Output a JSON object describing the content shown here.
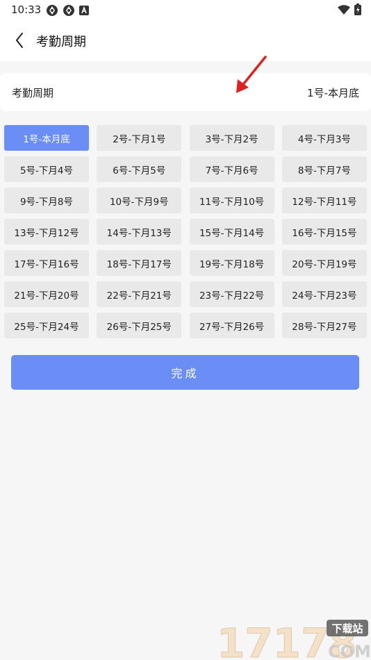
{
  "status_bar": {
    "time": "10:33",
    "left_icons": [
      "sync-icon",
      "sync-icon",
      "font-a-icon"
    ],
    "right_icons": [
      "wifi-icon",
      "battery-icon"
    ]
  },
  "nav": {
    "back_icon": "chevron-left-icon",
    "title": "考勤周期"
  },
  "field": {
    "label": "考勤周期",
    "value": "1号-本月底"
  },
  "options": [
    {
      "label": "1号-本月底",
      "selected": true
    },
    {
      "label": "2号-下月1号",
      "selected": false
    },
    {
      "label": "3号-下月2号",
      "selected": false
    },
    {
      "label": "4号-下月3号",
      "selected": false
    },
    {
      "label": "5号-下月4号",
      "selected": false
    },
    {
      "label": "6号-下月5号",
      "selected": false
    },
    {
      "label": "7号-下月6号",
      "selected": false
    },
    {
      "label": "8号-下月7号",
      "selected": false
    },
    {
      "label": "9号-下月8号",
      "selected": false
    },
    {
      "label": "10号-下月9号",
      "selected": false
    },
    {
      "label": "11号-下月10号",
      "selected": false
    },
    {
      "label": "12号-下月11号",
      "selected": false
    },
    {
      "label": "13号-下月12号",
      "selected": false
    },
    {
      "label": "14号-下月13号",
      "selected": false
    },
    {
      "label": "15号-下月14号",
      "selected": false
    },
    {
      "label": "16号-下月15号",
      "selected": false
    },
    {
      "label": "17号-下月16号",
      "selected": false
    },
    {
      "label": "18号-下月17号",
      "selected": false
    },
    {
      "label": "19号-下月18号",
      "selected": false
    },
    {
      "label": "20号-下月19号",
      "selected": false
    },
    {
      "label": "21号-下月20号",
      "selected": false
    },
    {
      "label": "22号-下月21号",
      "selected": false
    },
    {
      "label": "23号-下月22号",
      "selected": false
    },
    {
      "label": "24号-下月23号",
      "selected": false
    },
    {
      "label": "25号-下月24号",
      "selected": false
    },
    {
      "label": "26号-下月25号",
      "selected": false
    },
    {
      "label": "27号-下月26号",
      "selected": false
    },
    {
      "label": "28号-下月27号",
      "selected": false
    }
  ],
  "done_button": "完成",
  "watermark": {
    "number": "17178",
    "tag": "下载站",
    "domain": "COM"
  },
  "colors": {
    "accent": "#6b8ef6",
    "option_bg": "#e9e9e9",
    "page_bg": "#f6f6f6",
    "annotation_arrow": "#e02020"
  }
}
